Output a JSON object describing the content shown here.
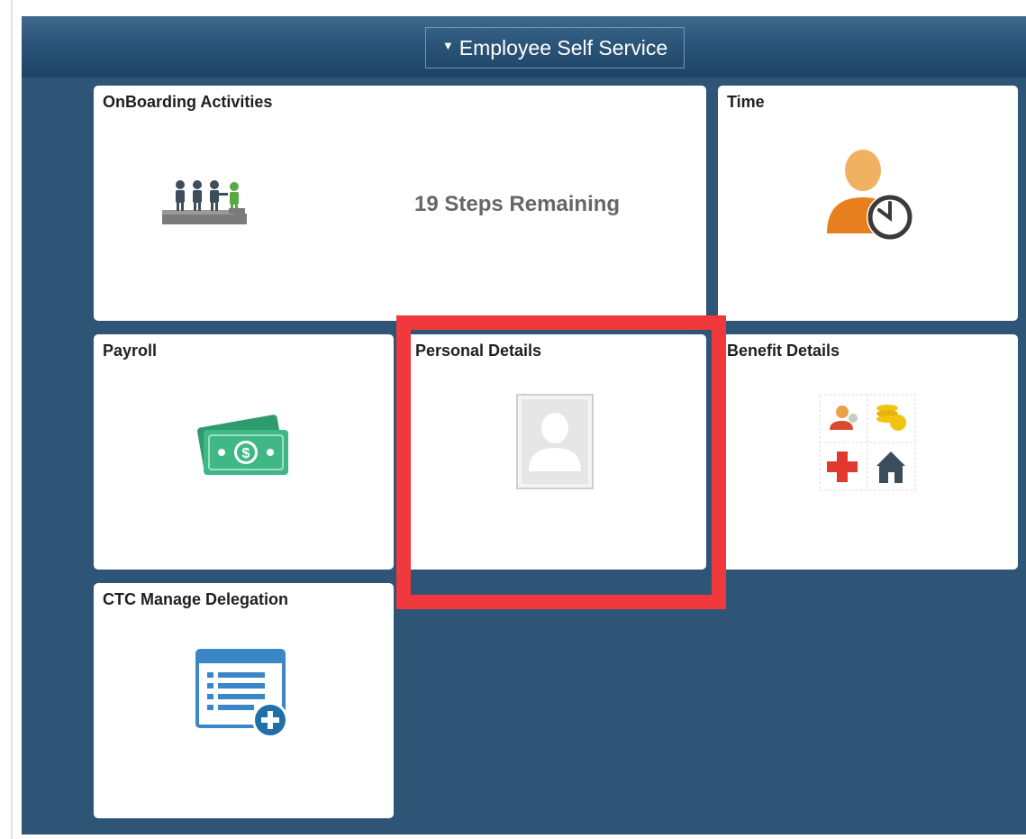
{
  "header": {
    "homepage_selector": {
      "caret": "▼",
      "label": "Employee Self Service"
    }
  },
  "tiles": {
    "onboarding": {
      "title": "OnBoarding Activities",
      "status": "19 Steps Remaining",
      "icon": "onboarding-people-icon"
    },
    "time": {
      "title": "Time",
      "icon": "person-clock-icon"
    },
    "payroll": {
      "title": "Payroll",
      "icon": "money-icon"
    },
    "personal_details": {
      "title": "Personal Details",
      "icon": "person-placeholder-icon"
    },
    "benefit_details": {
      "title": "Benefit Details",
      "icon": "benefits-grid-icon"
    },
    "ctc_manage_delegation": {
      "title": "CTC Manage Delegation",
      "icon": "list-add-icon"
    }
  },
  "colors": {
    "dashboard_bg": "#2f5576",
    "header_bg": "#2b5578",
    "highlight": "#f0393c",
    "tile_bg": "#ffffff"
  }
}
